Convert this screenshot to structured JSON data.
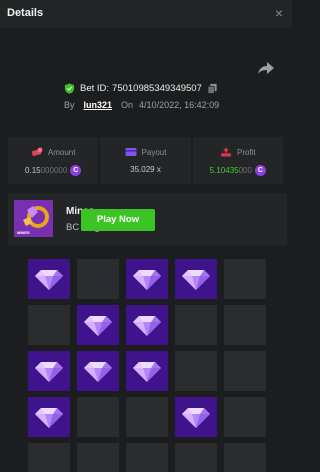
{
  "header": {
    "title": "Details",
    "close_label": "×"
  },
  "bet": {
    "id_label": "Bet ID:",
    "id": "75010985349349507",
    "by_label": "By",
    "username": "lun321",
    "on_label": "On",
    "datetime": "4/10/2022, 16:42:09"
  },
  "stats": {
    "amount": {
      "label": "Amount",
      "value_main": "0.15",
      "value_dim": "000000",
      "coin": "C"
    },
    "payout": {
      "label": "Payout",
      "value": "35.029 x"
    },
    "profit": {
      "label": "Profit",
      "value_main": "5.10435",
      "value_dim": "000",
      "coin": "C"
    }
  },
  "game": {
    "name": "Mines",
    "provider": "BC Originals",
    "thumb_label": "MINES",
    "play_label": "Play Now"
  },
  "colors": {
    "accent_green": "#3cc424",
    "gem_tile": "#3f138c",
    "empty_tile": "#2a2c2e",
    "coin": "#8c3fe0"
  },
  "mines_grid": {
    "columns": 5,
    "visible_rows": 5,
    "tiles": [
      "gem",
      "empty",
      "gem",
      "gem",
      "empty",
      "empty",
      "gem",
      "gem",
      "empty",
      "empty",
      "gem",
      "gem",
      "gem",
      "empty",
      "empty",
      "gem",
      "empty",
      "empty",
      "gem",
      "empty",
      "empty",
      "empty",
      "empty",
      "empty",
      "empty"
    ]
  }
}
